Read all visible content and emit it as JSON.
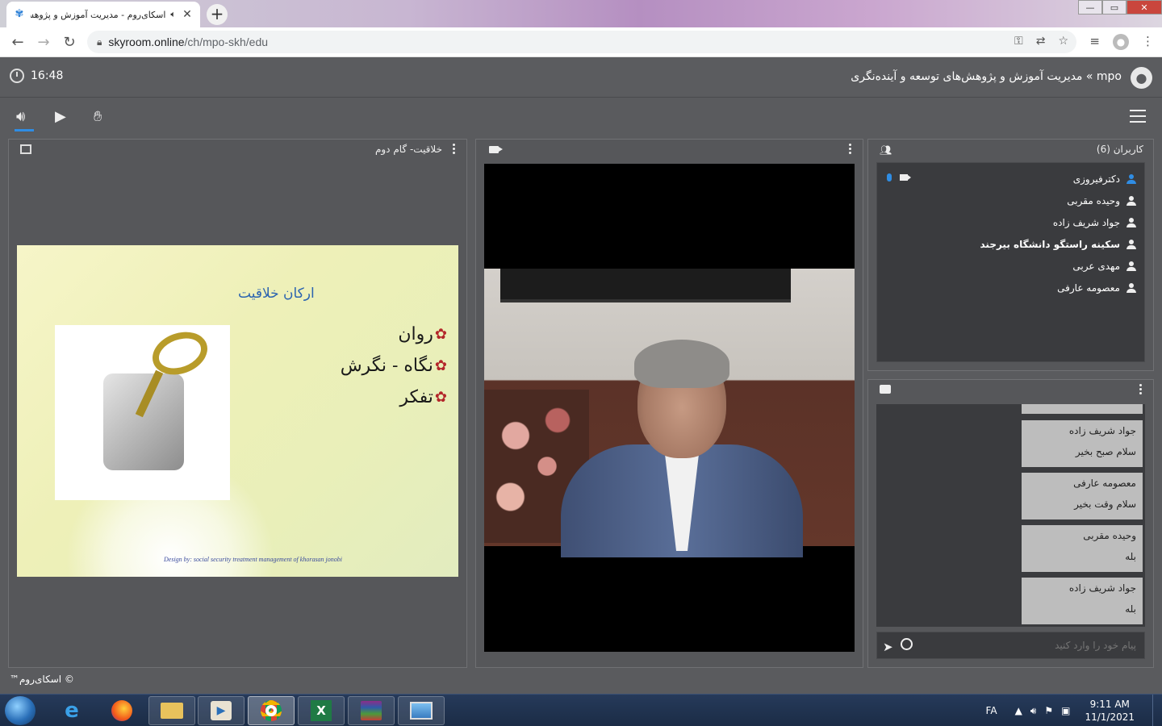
{
  "browser": {
    "tab_title": "اسکای‌روم - مدیریت آموزش و پژوهش...",
    "favicon": "skyroom-icon",
    "new_tab_label": "+",
    "url_host": "skyroom.online",
    "url_path": "/ch/mpo-skh/edu",
    "window_controls": {
      "minimize": "—",
      "maximize": "▭",
      "close": "✕"
    }
  },
  "app": {
    "clock": "16:48",
    "room_title": "mpo » مدیریت آموزش و پژوهش‌های توسعه و آینده‌نگری",
    "copyright": "© اسکای‌روم™"
  },
  "slide_panel": {
    "title": "خلاقیت- گام دوم",
    "slide": {
      "heading": "ارکان خلاقیت",
      "bullets": [
        "روان",
        "نگاه - نگرش",
        "تفکر"
      ],
      "footer": "Design by: social security treatment management of khorasan jonobi"
    }
  },
  "users_panel": {
    "title": "کاربران (6)",
    "users": [
      {
        "name": "دکترفیروزی",
        "presenter": true
      },
      {
        "name": "وحیده مقربی",
        "presenter": false
      },
      {
        "name": "جواد شریف زاده",
        "presenter": false
      },
      {
        "name": "سکینه راستگو دانشگاه بیرجند",
        "presenter": false
      },
      {
        "name": "مهدی عربی",
        "presenter": false
      },
      {
        "name": "معصومه عارفی",
        "presenter": false
      }
    ]
  },
  "chat_panel": {
    "messages": [
      {
        "author": "",
        "text": ""
      },
      {
        "author": "جواد شریف زاده",
        "text": "سلام صبح بخیر"
      },
      {
        "author": "معصومه عارفی",
        "text": "سلام وقت بخیر"
      },
      {
        "author": "وحیده مقربی",
        "text": "بله"
      },
      {
        "author": "جواد شریف زاده",
        "text": "بله"
      }
    ],
    "input_placeholder": "پیام خود را وارد کنید"
  },
  "taskbar": {
    "language": "FA",
    "time": "9:11 AM",
    "date": "11/1/2021"
  },
  "colors": {
    "accent": "#2f8de4",
    "panel_bg": "#56575a",
    "list_bg": "#3a3b3e",
    "message_bg": "#bdbdbd"
  }
}
